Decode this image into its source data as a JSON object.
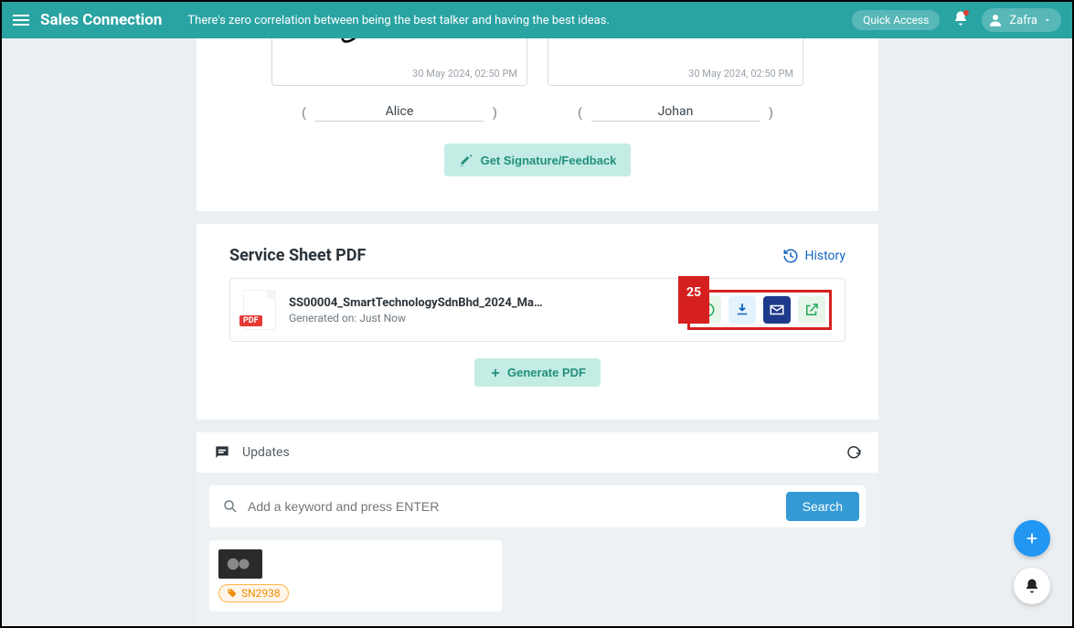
{
  "topbar": {
    "brand": "Sales Connection",
    "tagline": "There's zero correlation between being the best talker and having the best ideas.",
    "quick_access": "Quick Access",
    "user_name": "Zafra"
  },
  "signatures": {
    "left": {
      "date": "30 May 2024, 02:50 PM",
      "name": "Alice"
    },
    "right": {
      "date": "30 May 2024, 02:50 PM",
      "name": "Johan"
    },
    "get_feedback_label": "Get Signature/Feedback"
  },
  "pdf": {
    "section_title": "Service Sheet PDF",
    "history_label": "History",
    "filename": "SS00004_SmartTechnologySdnBhd_2024_Ma…",
    "generated_prefix": "Generated on: ",
    "generated_value": "Just Now",
    "badge_text": "PDF",
    "marker": "25",
    "generate_label": "Generate PDF"
  },
  "updates": {
    "label": "Updates",
    "search_placeholder": "Add a keyword and press ENTER",
    "search_button": "Search",
    "tag": "SN2938"
  }
}
